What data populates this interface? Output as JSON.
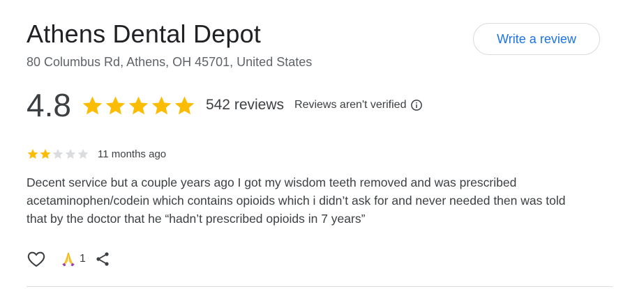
{
  "business": {
    "name": "Athens Dental Depot",
    "address": "80 Columbus Rd, Athens, OH 45701, United States"
  },
  "write_review_label": "Write a review",
  "summary": {
    "rating": "4.8",
    "stars_filled": 5,
    "review_count": "542 reviews",
    "verification_note": "Reviews aren't verified"
  },
  "review": {
    "stars_filled": 2,
    "stars_total": 5,
    "time": "11 months ago",
    "text": "Decent service but a couple years ago I got my wisdom teeth removed and was prescribed acetaminophen/codein which contains opioids which i didn’t ask for and never needed then was told that by the doctor that he “hadn’t prescribed opioids in 7 years”",
    "reaction_count": "1"
  },
  "colors": {
    "star_filled": "#fbbc04",
    "star_empty": "#dadce0",
    "link_blue": "#1a73e8"
  },
  "icons": [
    "star-icon",
    "info-icon",
    "heart-icon",
    "praying-hands-icon",
    "share-icon"
  ]
}
